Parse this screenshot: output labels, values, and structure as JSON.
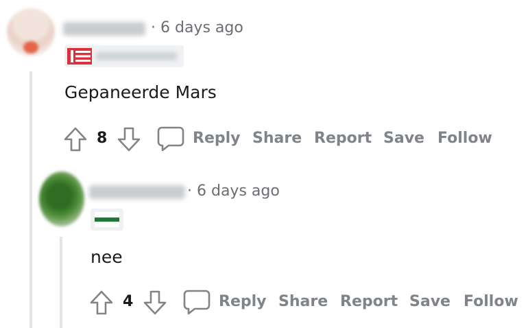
{
  "comments": [
    {
      "timestamp": "· 6 days ago",
      "body": "Gepaneerde Mars",
      "score": "8",
      "actions": {
        "reply": "Reply",
        "share": "Share",
        "report": "Report",
        "save": "Save",
        "follow": "Follow"
      },
      "flair_colors": {
        "stripes": "#d9323e"
      }
    },
    {
      "timestamp": "· 6 days ago",
      "body": "nee",
      "score": "4",
      "actions": {
        "reply": "Reply",
        "share": "Share",
        "report": "Report",
        "save": "Save",
        "follow": "Follow"
      },
      "flair_colors": {
        "top": "#ffffff",
        "middle": "#1f7a3a",
        "bottom": "#ffffff"
      }
    }
  ]
}
